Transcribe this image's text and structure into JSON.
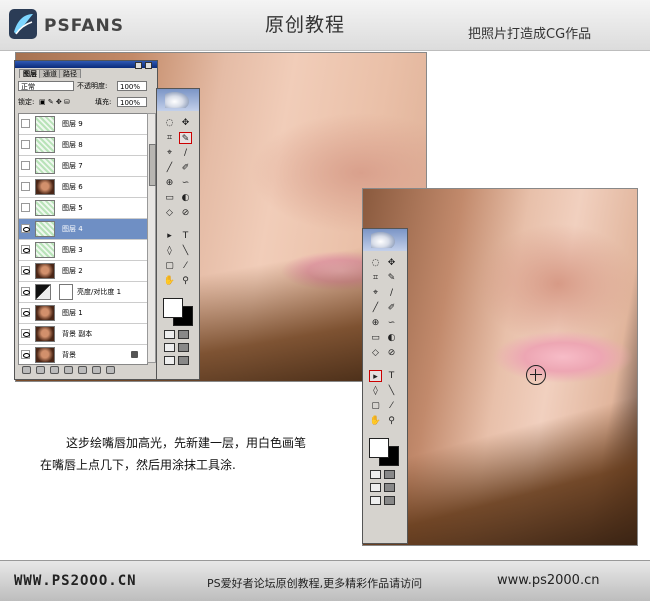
{
  "header": {
    "logo_text": "PSFANS",
    "title": "原创教程",
    "subtitle": "把照片打造成CG作品"
  },
  "layers_panel": {
    "tabs": [
      "图层",
      "通道",
      "路径"
    ],
    "blend_mode": "正常",
    "opacity_label": "不透明度:",
    "opacity_value": "100%",
    "lock_label": "锁定:",
    "fill_label": "填充:",
    "fill_value": "100%",
    "layers": [
      {
        "name": "图层 9",
        "thumb": "t",
        "visible": false,
        "selected": false
      },
      {
        "name": "图层 8",
        "thumb": "t",
        "visible": false,
        "selected": false
      },
      {
        "name": "图层 7",
        "thumb": "t",
        "visible": false,
        "selected": false
      },
      {
        "name": "图层 6",
        "thumb": "p",
        "visible": false,
        "selected": false
      },
      {
        "name": "图层 5",
        "thumb": "t",
        "visible": false,
        "selected": false
      },
      {
        "name": "图层 4",
        "thumb": "t",
        "visible": true,
        "selected": true
      },
      {
        "name": "图层 3",
        "thumb": "t",
        "visible": true,
        "selected": false
      },
      {
        "name": "图层 2",
        "thumb": "p",
        "visible": true,
        "selected": false
      },
      {
        "name": "亮度/对比度 1",
        "thumb": "a",
        "visible": true,
        "selected": false
      },
      {
        "name": "图层 1",
        "thumb": "p",
        "visible": true,
        "selected": false
      },
      {
        "name": "背景 副本",
        "thumb": "p",
        "visible": true,
        "selected": false
      },
      {
        "name": "背景",
        "thumb": "p",
        "visible": true,
        "selected": false
      }
    ]
  },
  "toolbox": {
    "tools": [
      "◌",
      "✥",
      "⌗",
      "✎",
      "⌖",
      "∕",
      "╱",
      "✐",
      "⊕",
      "∽",
      "▭",
      "◐",
      "◇",
      "⊘",
      "▸",
      "T",
      "◊",
      "╲",
      "▢",
      "⁄",
      "✋",
      "⚲"
    ],
    "highlighted_tool": "brush"
  },
  "caption": {
    "line1": "这步绘嘴唇加高光，先新建一层，用白色画笔",
    "line2": "在嘴唇上点几下，然后用涂抹工具涂."
  },
  "footer": {
    "site": "WWW.PS2OOO.CN",
    "message": "PS爱好者论坛原创教程,更多精彩作品请访问",
    "url": "www.ps2000.cn"
  }
}
